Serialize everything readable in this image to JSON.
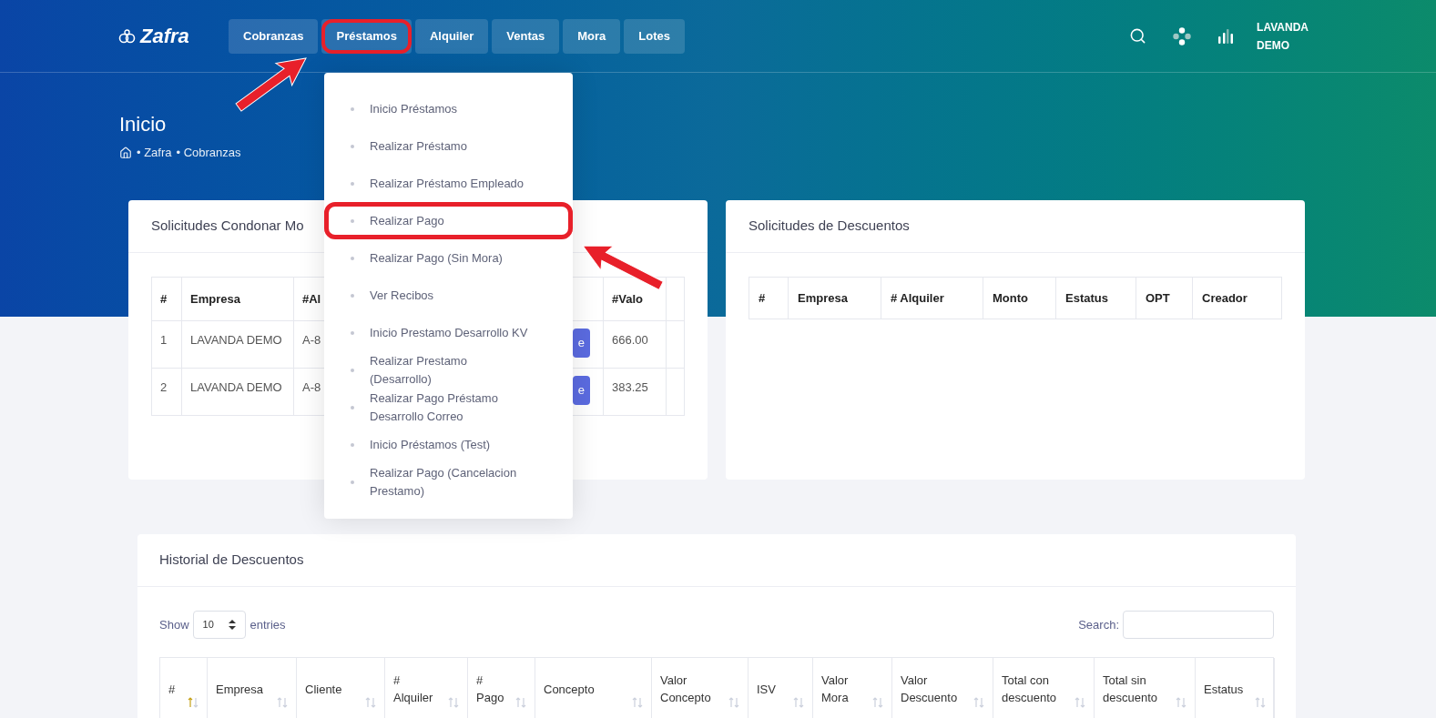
{
  "brand": "Zafra",
  "nav": [
    {
      "label": "Cobranzas",
      "highlighted": false
    },
    {
      "label": "Préstamos",
      "highlighted": true
    },
    {
      "label": "Alquiler",
      "highlighted": false
    },
    {
      "label": "Ventas",
      "highlighted": false
    },
    {
      "label": "Mora",
      "highlighted": false
    },
    {
      "label": "Lotes",
      "highlighted": false
    }
  ],
  "user": "LAVANDA\nDEMO",
  "page_title": "Inicio",
  "breadcrumb": [
    "• Zafra",
    "• Cobranzas"
  ],
  "menu": [
    {
      "label": "Inicio Préstamos",
      "highlighted": false
    },
    {
      "label": "Realizar Préstamo",
      "highlighted": false
    },
    {
      "label": "Realizar Préstamo Empleado",
      "highlighted": false
    },
    {
      "label": "Realizar Pago",
      "highlighted": true
    },
    {
      "label": "Realizar Pago (Sin Mora)",
      "highlighted": false
    },
    {
      "label": "Ver Recibos",
      "highlighted": false
    },
    {
      "label": "Inicio Prestamo Desarrollo KV",
      "highlighted": false
    },
    {
      "label": "Realizar Prestamo\n(Desarrollo)",
      "highlighted": false
    },
    {
      "label": "Realizar Pago Préstamo\nDesarrollo Correo",
      "highlighted": false
    },
    {
      "label": "Inicio Préstamos (Test)",
      "highlighted": false
    },
    {
      "label": "Realizar Pago (Cancelacion\nPrestamo)",
      "highlighted": false
    }
  ],
  "condonar_card": {
    "title": "Solicitudes Condonar Mo",
    "columns": [
      "#",
      "Empresa",
      "#Al",
      "#Valo"
    ],
    "rows": [
      {
        "cells": [
          "1",
          "LAVANDA DEMO",
          "A-8",
          "666.00"
        ],
        "button": "e"
      },
      {
        "cells": [
          "2",
          "LAVANDA DEMO",
          "A-8",
          "383.25"
        ],
        "button": "e"
      }
    ]
  },
  "descuentos_card": {
    "title": "Solicitudes de Descuentos",
    "columns": [
      "#",
      "Empresa",
      "# Alquiler",
      "Monto",
      "Estatus",
      "OPT",
      "Creador"
    ]
  },
  "historial_card": {
    "title": "Historial de Descuentos",
    "show_label": "Show",
    "page_size": "10",
    "entries_label": "entries",
    "search_label": "Search:",
    "columns": [
      {
        "label": "#",
        "sorted": true
      },
      {
        "label": "Empresa",
        "sorted": false
      },
      {
        "label": "Cliente",
        "sorted": false
      },
      {
        "label": "#\nAlquiler",
        "sorted": false
      },
      {
        "label": "#\nPago",
        "sorted": false
      },
      {
        "label": "Concepto",
        "sorted": false
      },
      {
        "label": "Valor\nConcepto",
        "sorted": false
      },
      {
        "label": "ISV",
        "sorted": false
      },
      {
        "label": "Valor\nMora",
        "sorted": false
      },
      {
        "label": "Valor\nDescuento",
        "sorted": false
      },
      {
        "label": "Total con\ndescuento",
        "sorted": false
      },
      {
        "label": "Total sin\ndescuento",
        "sorted": false
      },
      {
        "label": "Estatus",
        "sorted": false
      }
    ]
  }
}
